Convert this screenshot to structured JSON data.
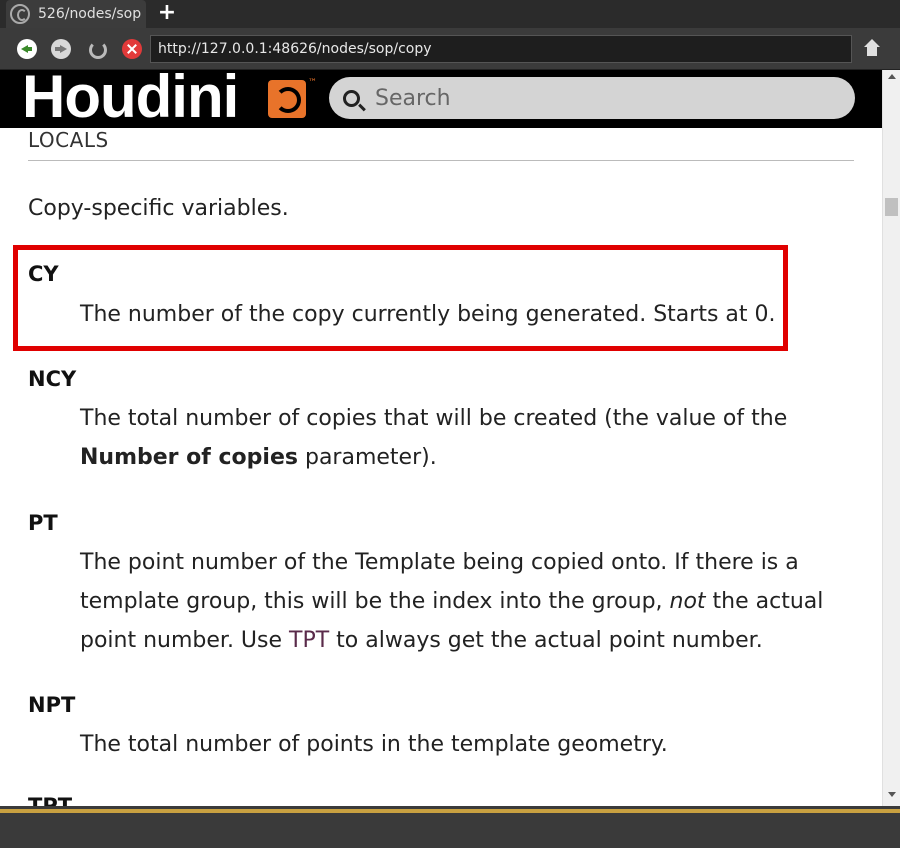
{
  "browser": {
    "tab_title": "526/nodes/sop",
    "new_tab_label": "+",
    "url": "http://127.0.0.1:48626/nodes/sop/copy"
  },
  "header": {
    "logo_text": "Houdini",
    "logo_tm": "™",
    "search_placeholder": "Search"
  },
  "content": {
    "section_heading": "LOCALS",
    "intro": "Copy-specific variables.",
    "variables": [
      {
        "name": "CY",
        "desc": "The number of the copy currently being generated. Starts at 0.",
        "highlighted": true
      },
      {
        "name": "NCY",
        "desc_part1": "The total number of copies that will be created (the value of the",
        "desc_bold": "Number of copies",
        "desc_part2": " parameter)."
      },
      {
        "name": "PT",
        "desc_line1": "The point number of the Template being copied onto. If there is a",
        "desc_line2a": "template group, this will be the index into the group, ",
        "desc_italic": "not",
        "desc_line2b": " the actual",
        "desc_line3a": "point number. Use ",
        "desc_code": "TPT",
        "desc_line3b": " to always get the actual point number."
      },
      {
        "name": "NPT",
        "desc": "The total number of points in the template geometry."
      },
      {
        "name": "TPT"
      }
    ]
  },
  "colors": {
    "highlight_border": "#e00000",
    "logo_orange": "#e8732a",
    "bottom_gold": "#c8a040"
  }
}
